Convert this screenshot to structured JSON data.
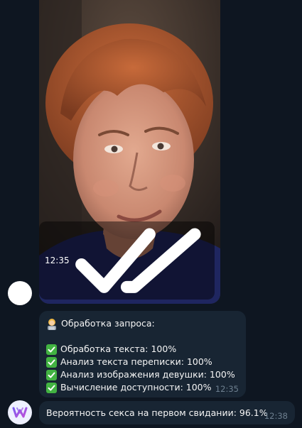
{
  "messages": [
    {
      "type": "photo",
      "time": "12:35",
      "status": "read"
    },
    {
      "type": "text",
      "header_icon": "woman-technologist-emoji",
      "header": "Обработка запроса:",
      "checks": [
        "Обработка текста: 100%",
        "Анализ текста переписки: 100%",
        "Анализ изображения девушки: 100%",
        "Вычисление доступности: 100%"
      ],
      "check_icon": "check-mark-button-emoji",
      "time": "12:35"
    },
    {
      "type": "text",
      "text": "Вероятность секса на первом свидании: 96.1%",
      "time": "12:38"
    }
  ],
  "colors": {
    "background": "#0e1621",
    "bubble": "#182533",
    "check": "#42b342",
    "time": "#6d7f8f"
  }
}
